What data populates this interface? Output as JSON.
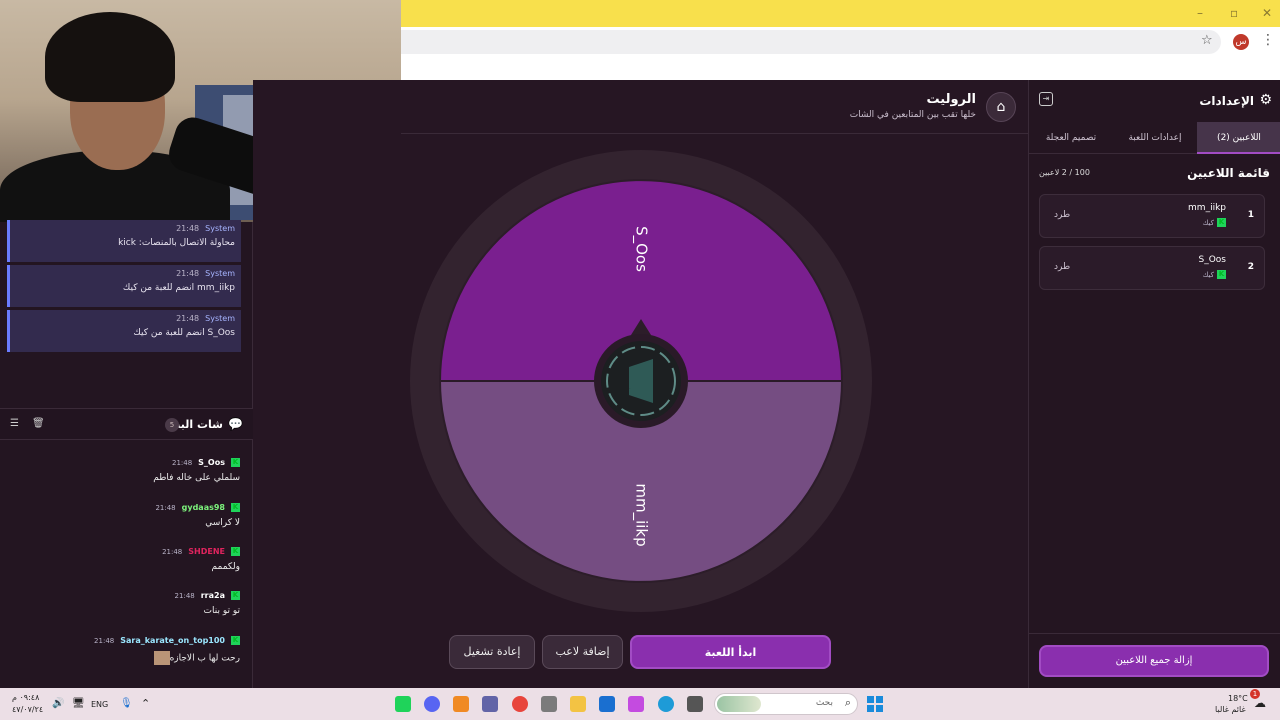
{
  "browser": {
    "profile_initial": "س",
    "star_icon": "star-icon",
    "menu_icon": "kebab-menu-icon"
  },
  "system_messages": [
    {
      "sender": "System",
      "time": "21:48",
      "text": "محاولة الاتصال بالمنصات: kick"
    },
    {
      "sender": "System",
      "time": "21:48",
      "text": "mm_iikp انضم للعبة من كيك"
    },
    {
      "sender": "System",
      "time": "21:48",
      "text": "S_Oos انضم للعبة من كيك"
    }
  ],
  "chat": {
    "title": "شات البث",
    "count": "5",
    "messages": [
      {
        "user": "S_Oos",
        "user_color": "#ffffff",
        "time": "21:48",
        "text": "سلملي على خاله فاطم"
      },
      {
        "user": "gydaas98",
        "user_color": "#7cf37c",
        "time": "21:48",
        "text": "لا كراسي"
      },
      {
        "user": "SHDENE",
        "user_color": "#e0245e",
        "time": "21:48",
        "text": "ولكممم"
      },
      {
        "user": "rra2a",
        "user_color": "#ffffff",
        "time": "21:48",
        "text": "تو تو بنات"
      },
      {
        "user": "Sara_karate_on_top100",
        "user_color": "#9be7ff",
        "time": "21:48",
        "text": "رحت لها ب الاجازه"
      }
    ]
  },
  "app": {
    "title": "الروليت",
    "subtitle": "خلها تقب بين المتابعين في الشات",
    "buttons": {
      "start": "ابدأ اللعبة",
      "add_player": "إضافة لاعب",
      "restart": "إعادة تشغيل"
    }
  },
  "wheel": {
    "segments": [
      {
        "label": "S_Oos",
        "color": "#7a1f8f"
      },
      {
        "label": "mm_iikp",
        "color": "#754d82"
      }
    ]
  },
  "settings": {
    "title": "الإعدادات",
    "tabs": [
      "اللاعبين (2)",
      "إعدادات اللعبة",
      "تصميم العجلة"
    ],
    "active_tab": 0,
    "list_title": "قائمة اللاعبين",
    "count_label": "100 / 2 لاعبين",
    "players": [
      {
        "num": "1",
        "name": "mm_iikp",
        "platform": "كيك",
        "kick": "طرد"
      },
      {
        "num": "2",
        "name": "S_Oos",
        "platform": "كيك",
        "kick": "طرد"
      }
    ],
    "remove_all": "إزالة جميع اللاعبين"
  },
  "taskbar": {
    "search_placeholder": "بحث",
    "language": "ENG",
    "time": "٠٩:٤٨ م",
    "date": "٤٧/٠٧/٢٤",
    "weather_temp": "18°C",
    "weather_text": "غائم غالبا",
    "notification_count": "1",
    "colors": {
      "accent": "#8a2fae",
      "kick_green": "#1fd35a"
    }
  }
}
